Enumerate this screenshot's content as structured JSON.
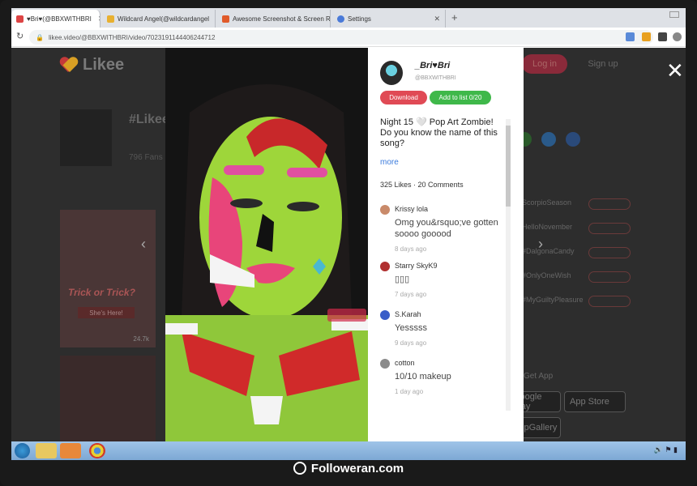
{
  "browser": {
    "tabs": [
      {
        "label": "♥Bri♥(@BBXWITHBRI",
        "active": true
      },
      {
        "label": "Wildcard Angel(@wildcardangel",
        "active": false
      },
      {
        "label": "Awesome Screenshot & Screen R",
        "active": false
      },
      {
        "label": "Settings",
        "active": false
      }
    ],
    "new_tab": "+",
    "url": "likee.video/@BBXWITHBRI/video/7023191144406244712"
  },
  "site": {
    "logo_text": "Likee",
    "login_label": "Log in",
    "signup_label": "Sign up",
    "hashtag_title": "#Likee",
    "fans_text": "796 Fans",
    "sidebar_names": [
      "ScorpioSeason",
      "HelloNovember",
      "#DalgonaCandy",
      "#OnlyOneWish",
      "#MyGuiltyPleasure"
    ],
    "card_caption": "Trick or Trick?",
    "card_sub": "She's Here!",
    "card_views": "24.7k",
    "get_app": "Get App",
    "google_play": "Google Play",
    "app_store": "App Store",
    "app_gallery": "AppGallery"
  },
  "modal": {
    "username": "_Bri♥Bri",
    "handle": "@BBXWITHBRI",
    "download_label": "Download",
    "add_list_label": "Add to list 0/20",
    "description": "Night 15 🤍 Pop Art Zombie! Do you know the name of this song?",
    "more_label": "more",
    "likes": "325 Likes",
    "comments_count": "20 Comments",
    "close_label": "✕",
    "comments": [
      {
        "name": "Krissy lola",
        "text": "Omg you&rsquo;ve gotten soooo gooood",
        "time": "8 days ago",
        "color": "#c98a6a"
      },
      {
        "name": "Starry SkyK9",
        "text": "▯▯▯",
        "time": "7 days ago",
        "color": "#b03030"
      },
      {
        "name": "S.Karah",
        "text": "Yesssss",
        "time": "9 days ago",
        "color": "#3a5ec8"
      },
      {
        "name": "cotton",
        "text": "10/10 makeup",
        "time": "1 day ago",
        "color": "#8a8a8a"
      }
    ]
  },
  "watermark": "Followeran.com"
}
